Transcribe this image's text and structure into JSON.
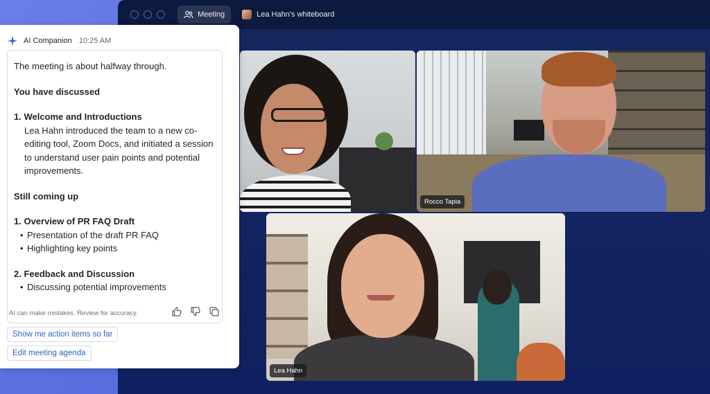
{
  "titlebar": {
    "meeting_tab": "Meeting",
    "whiteboard_tab": "Lea Hahn's whiteboard"
  },
  "participants": [
    {
      "name": ""
    },
    {
      "name": "Rocco Tapia"
    },
    {
      "name": "Lea Hahn"
    }
  ],
  "ai": {
    "title": "AI Companion",
    "time": "10:25 AM",
    "intro": "The meeting is about halfway through.",
    "discussed_heading": "You have discussed",
    "discussed_item_title": "1. Welcome and Introductions",
    "discussed_item_body": "Lea Hahn introduced the team to a new co-editing tool, Zoom Docs, and initiated a session to understand user pain points and potential improvements.",
    "coming_heading": "Still coming up",
    "coming_items": [
      {
        "title": "1. Overview of PR FAQ Draft",
        "bullets": [
          "Presentation of the draft PR FAQ",
          "Highlighting key points"
        ]
      },
      {
        "title": "2. Feedback and Discussion",
        "bullets": [
          "Discussing potential improvements"
        ]
      }
    ],
    "disclaimer": "AI can make mistakes. Review for accuracy.",
    "suggestions": [
      "Show me action items so far",
      "Edit meeting agenda"
    ]
  },
  "colors": {
    "accent": "#2d63c8",
    "window_bg": "#14285e",
    "page_bg": "#5a6fe0"
  }
}
